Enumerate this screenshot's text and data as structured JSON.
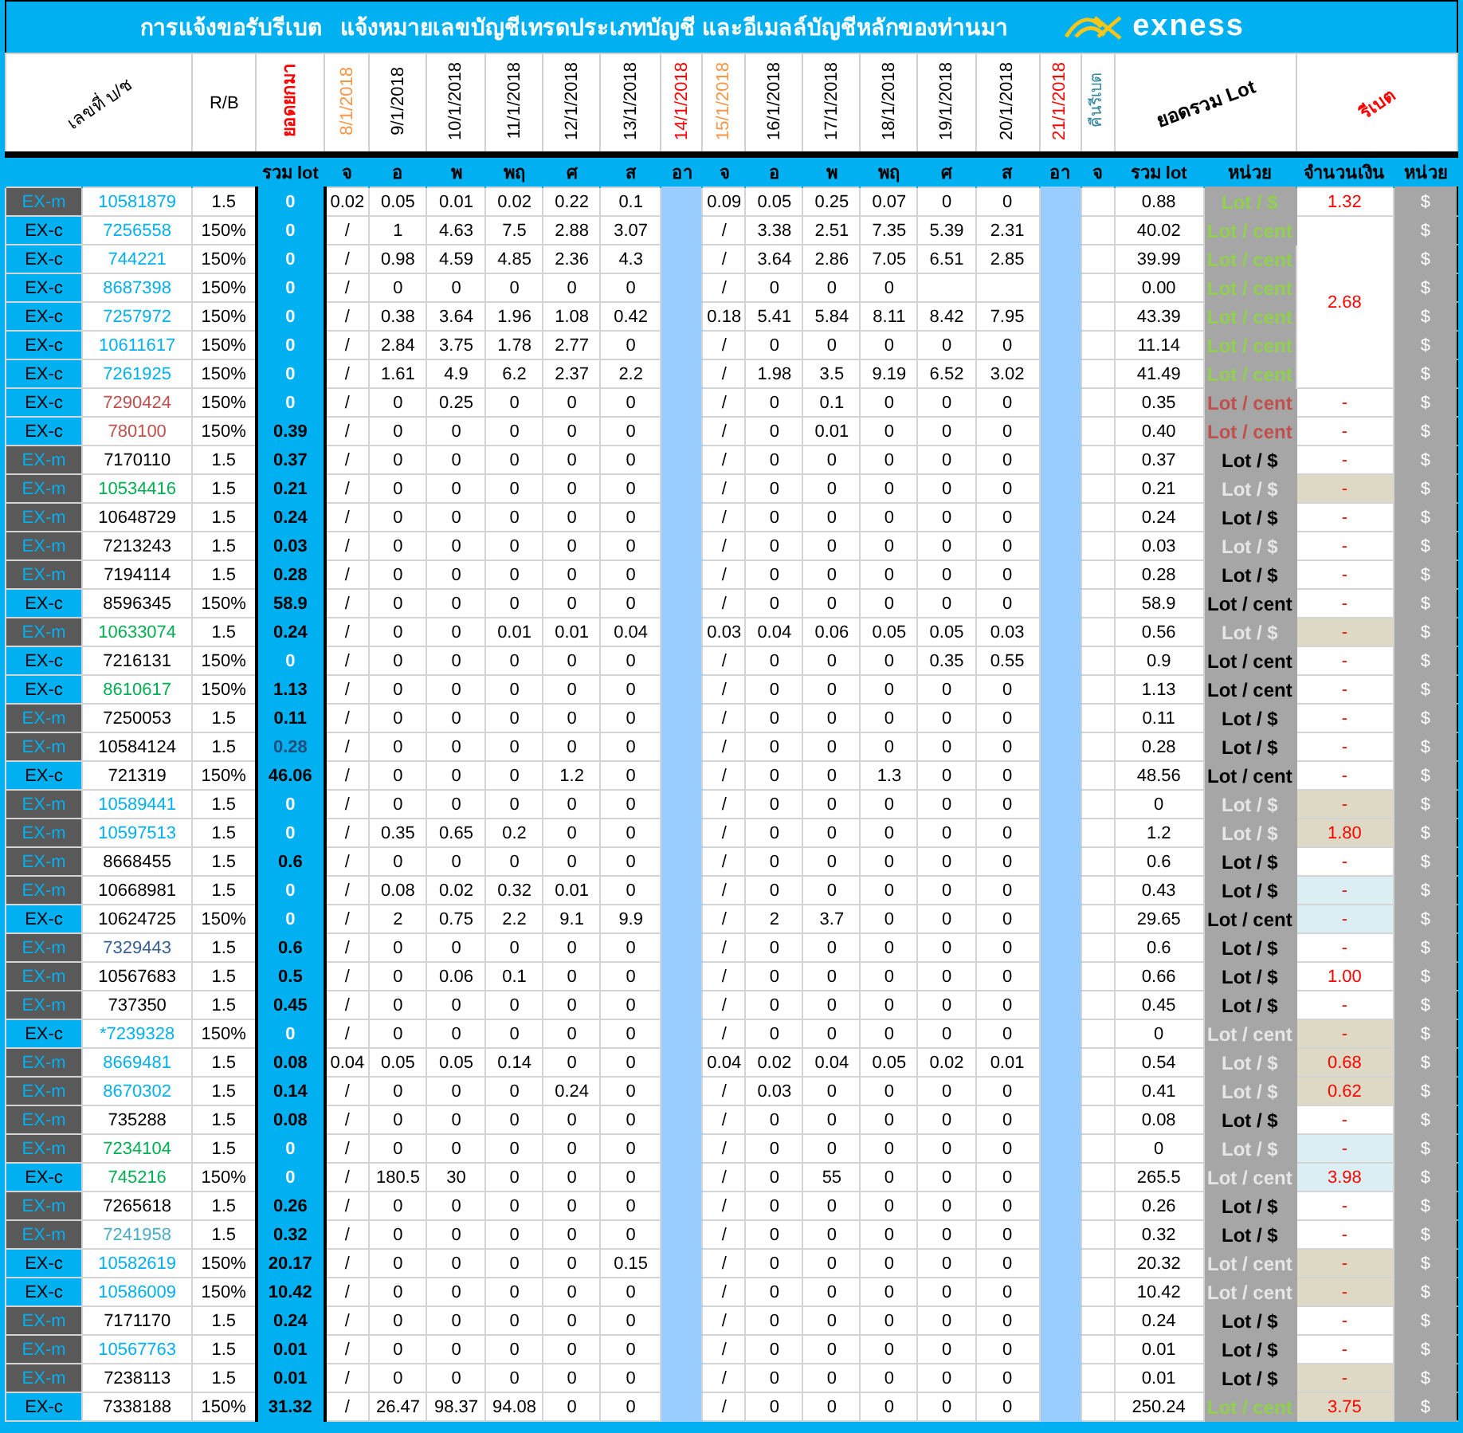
{
  "title": {
    "text": "การแจ้งขอรับรีเบต   แจ้งหมายเลขบัญชีเทรดประเภทบัญชี และอีเมลล์บัญชีหลักของท่านมา",
    "brand": "exness"
  },
  "header": {
    "account": "เลขที่ บ/ช",
    "rb": "R/B",
    "carried": {
      "text": "ยอดยกมา",
      "color": "#ff0000"
    },
    "dates": [
      {
        "text": "8/1/2018",
        "color": "#f79646"
      },
      {
        "text": "9/1/2018",
        "color": "#000000"
      },
      {
        "text": "10/1/2018",
        "color": "#000000"
      },
      {
        "text": "11/1/2018",
        "color": "#000000"
      },
      {
        "text": "12/1/2018",
        "color": "#000000"
      },
      {
        "text": "13/1/2018",
        "color": "#000000"
      },
      {
        "text": "14/1/2018",
        "color": "#ff0000"
      },
      {
        "text": "15/1/2018",
        "color": "#f79646"
      },
      {
        "text": "16/1/2018",
        "color": "#000000"
      },
      {
        "text": "17/1/2018",
        "color": "#000000"
      },
      {
        "text": "18/1/2018",
        "color": "#000000"
      },
      {
        "text": "19/1/2018",
        "color": "#000000"
      },
      {
        "text": "20/1/2018",
        "color": "#000000"
      },
      {
        "text": "21/1/2018",
        "color": "#ff0000"
      }
    ],
    "refund": {
      "text": "คืนรีเบต",
      "color": "#31859c"
    },
    "total": "ยอดรวม Lot",
    "rebate": {
      "text": "รีเบต",
      "color": "#ff0000"
    }
  },
  "subheader": {
    "carried_total": "รวม lot",
    "days": [
      "จ",
      "อ",
      "พ",
      "พฤ",
      "ศ",
      "ส",
      "อา",
      "จ",
      "อ",
      "พ",
      "พฤ",
      "ศ",
      "ส",
      "อา",
      "จ"
    ],
    "total": "รวม lot",
    "unit": "หน่วย",
    "amount": "จำนวนเงิน",
    "currency": "หน่วย"
  },
  "rows": [
    {
      "type": "EX-m",
      "kind": "m",
      "account": "10581879",
      "color": "#00b0f0",
      "rb": "1.5",
      "carried": {
        "text": "0",
        "color": "#ffffff"
      },
      "week1": [
        "0.02",
        "0.05",
        "0.01",
        "0.02",
        "0.22",
        "0.1"
      ],
      "week2": [
        "0.09",
        "0.05",
        "0.25",
        "0.07",
        "0",
        "0"
      ],
      "total": "0.88",
      "unit": {
        "text": "Lot / $",
        "color": "#92d050"
      },
      "amount": {
        "text": "1.32",
        "color": "#ffffff"
      },
      "currency": "$"
    },
    {
      "type": "EX-c",
      "kind": "c",
      "account": "7256558",
      "color": "#00b0f0",
      "rb": "150%",
      "carried": {
        "text": "0",
        "color": "#ffffff"
      },
      "week1": [
        "/",
        "1",
        "4.63",
        "7.5",
        "2.88",
        "3.07"
      ],
      "week2": [
        "/",
        "3.38",
        "2.51",
        "7.35",
        "5.39",
        "2.31"
      ],
      "total": "40.02",
      "unit": {
        "text": "Lot / cent",
        "color": "#92d050"
      },
      "amount": {
        "text": "2.68",
        "color": "#ffffff"
      },
      "currency": "$"
    },
    {
      "type": "EX-c",
      "kind": "c",
      "account": "744221",
      "color": "#00b0f0",
      "rb": "150%",
      "carried": {
        "text": "0",
        "color": "#ffffff"
      },
      "week1": [
        "/",
        "0.98",
        "4.59",
        "4.85",
        "2.36",
        "4.3"
      ],
      "week2": [
        "/",
        "3.64",
        "2.86",
        "7.05",
        "6.51",
        "2.85"
      ],
      "total": "39.99",
      "unit": {
        "text": "Lot / cent",
        "color": "#92d050"
      },
      "currency": "$"
    },
    {
      "type": "EX-c",
      "kind": "c",
      "account": "8687398",
      "color": "#00b0f0",
      "rb": "150%",
      "carried": {
        "text": "0",
        "color": "#ffffff"
      },
      "week1": [
        "/",
        "0",
        "0",
        "0",
        "0",
        "0"
      ],
      "week2": [
        "/",
        "0",
        "0",
        "0"
      ],
      "total": "0.00",
      "unit": {
        "text": "Lot / cent",
        "color": "#92d050"
      },
      "currency": "$"
    },
    {
      "type": "EX-c",
      "kind": "c",
      "account": "7257972",
      "color": "#00b0f0",
      "rb": "150%",
      "carried": {
        "text": "0",
        "color": "#ffffff"
      },
      "week1": [
        "/",
        "0.38",
        "3.64",
        "1.96",
        "1.08",
        "0.42"
      ],
      "week2": [
        "0.18",
        "5.41",
        "5.84",
        "8.11",
        "8.42",
        "7.95"
      ],
      "total": "43.39",
      "unit": {
        "text": "Lot / cent",
        "color": "#92d050"
      },
      "currency": "$"
    },
    {
      "type": "EX-c",
      "kind": "c",
      "account": "10611617",
      "color": "#00b0f0",
      "rb": "150%",
      "carried": {
        "text": "0",
        "color": "#ffffff"
      },
      "week1": [
        "/",
        "2.84",
        "3.75",
        "1.78",
        "2.77",
        "0"
      ],
      "week2": [
        "/",
        "0",
        "0",
        "0",
        "0",
        "0"
      ],
      "total": "11.14",
      "unit": {
        "text": "Lot / cent",
        "color": "#92d050"
      },
      "currency": "$"
    },
    {
      "type": "EX-c",
      "kind": "c",
      "account": "7261925",
      "color": "#00b0f0",
      "rb": "150%",
      "carried": {
        "text": "0",
        "color": "#ffffff"
      },
      "week1": [
        "/",
        "1.61",
        "4.9",
        "6.2",
        "2.37",
        "2.2"
      ],
      "week2": [
        "/",
        "1.98",
        "3.5",
        "9.19",
        "6.52",
        "3.02"
      ],
      "total": "41.49",
      "unit": {
        "text": "Lot / cent",
        "color": "#92d050"
      },
      "currency": "$"
    },
    {
      "type": "EX-c",
      "kind": "c",
      "account": "7290424",
      "color": "#c0504d",
      "rb": "150%",
      "carried": {
        "text": "0",
        "color": "#ffffff"
      },
      "week1": [
        "/",
        "0",
        "0.25",
        "0",
        "0",
        "0"
      ],
      "week2": [
        "/",
        "0",
        "0.1",
        "0",
        "0",
        "0"
      ],
      "total": "0.35",
      "unit": {
        "text": "Lot / cent",
        "color": "#c0504d"
      },
      "amount": {
        "text": "-",
        "color": "#ffffff"
      },
      "currency": "$"
    },
    {
      "type": "EX-c",
      "kind": "c",
      "account": "780100",
      "color": "#c0504d",
      "rb": "150%",
      "carried": {
        "text": "0.39",
        "color": "#000000"
      },
      "week1": [
        "/",
        "0",
        "0",
        "0",
        "0",
        "0"
      ],
      "week2": [
        "/",
        "0",
        "0.01",
        "0",
        "0",
        "0"
      ],
      "total": "0.40",
      "unit": {
        "text": "Lot / cent",
        "color": "#c0504d"
      },
      "amount": {
        "text": "-",
        "color": "#ffffff"
      },
      "currency": "$"
    },
    {
      "type": "EX-m",
      "kind": "m",
      "account": "7170110",
      "color": "#000000",
      "rb": "1.5",
      "carried": {
        "text": "0.37",
        "color": "#000000"
      },
      "week1": [
        "/",
        "0",
        "0",
        "0",
        "0",
        "0"
      ],
      "week2": [
        "/",
        "0",
        "0",
        "0",
        "0",
        "0"
      ],
      "total": "0.37",
      "unit": {
        "text": "Lot / $",
        "color": "#000000"
      },
      "amount": {
        "text": "-",
        "color": "#ffffff"
      },
      "currency": "$"
    },
    {
      "type": "EX-m",
      "kind": "m",
      "account": "10534416",
      "color": "#00b050",
      "rb": "1.5",
      "carried": {
        "text": "0.21",
        "color": "#000000"
      },
      "week1": [
        "/",
        "0",
        "0",
        "0",
        "0",
        "0"
      ],
      "week2": [
        "/",
        "0",
        "0",
        "0",
        "0",
        "0"
      ],
      "total": "0.21",
      "unit": {
        "text": "Lot / $",
        "color": "#e6e6e6"
      },
      "amount": {
        "text": "-",
        "color": "#ddd9c4"
      },
      "currency": "$"
    },
    {
      "type": "EX-m",
      "kind": "m",
      "account": "10648729",
      "color": "#000000",
      "rb": "1.5",
      "carried": {
        "text": "0.24",
        "color": "#000000"
      },
      "week1": [
        "/",
        "0",
        "0",
        "0",
        "0",
        "0"
      ],
      "week2": [
        "/",
        "0",
        "0",
        "0",
        "0",
        "0"
      ],
      "total": "0.24",
      "unit": {
        "text": "Lot / $",
        "color": "#000000"
      },
      "amount": {
        "text": "-",
        "color": "#ffffff"
      },
      "currency": "$"
    },
    {
      "type": "EX-m",
      "kind": "m",
      "account": "7213243",
      "color": "#000000",
      "rb": "1.5",
      "carried": {
        "text": "0.03",
        "color": "#000000"
      },
      "week1": [
        "/",
        "0",
        "0",
        "0",
        "0",
        "0"
      ],
      "week2": [
        "/",
        "0",
        "0",
        "0",
        "0",
        "0"
      ],
      "total": "0.03",
      "unit": {
        "text": "Lot / $",
        "color": "#e6e6e6"
      },
      "amount": {
        "text": "-",
        "color": "#ffffff"
      },
      "currency": "$"
    },
    {
      "type": "EX-m",
      "kind": "m",
      "account": "7194114",
      "color": "#000000",
      "rb": "1.5",
      "carried": {
        "text": "0.28",
        "color": "#000000"
      },
      "week1": [
        "/",
        "0",
        "0",
        "0",
        "0",
        "0"
      ],
      "week2": [
        "/",
        "0",
        "0",
        "0",
        "0",
        "0"
      ],
      "total": "0.28",
      "unit": {
        "text": "Lot / $",
        "color": "#000000"
      },
      "amount": {
        "text": "-",
        "color": "#ffffff"
      },
      "currency": "$"
    },
    {
      "type": "EX-c",
      "kind": "c",
      "account": "8596345",
      "color": "#000000",
      "rb": "150%",
      "carried": {
        "text": "58.9",
        "color": "#000000"
      },
      "week1": [
        "/",
        "0",
        "0",
        "0",
        "0",
        "0"
      ],
      "week2": [
        "/",
        "0",
        "0",
        "0",
        "0",
        "0"
      ],
      "total": "58.9",
      "unit": {
        "text": "Lot / cent",
        "color": "#000000"
      },
      "amount": {
        "text": "-",
        "color": "#ffffff"
      },
      "currency": "$"
    },
    {
      "type": "EX-m",
      "kind": "m",
      "account": "10633074",
      "color": "#00b050",
      "rb": "1.5",
      "carried": {
        "text": "0.24",
        "color": "#000000"
      },
      "week1": [
        "/",
        "0",
        "0",
        "0.01",
        "0.01",
        "0.04"
      ],
      "week2": [
        "0.03",
        "0.04",
        "0.06",
        "0.05",
        "0.05",
        "0.03"
      ],
      "total": "0.56",
      "unit": {
        "text": "Lot / $",
        "color": "#e6e6e6"
      },
      "amount": {
        "text": "-",
        "color": "#ddd9c4"
      },
      "currency": "$"
    },
    {
      "type": "EX-c",
      "kind": "c",
      "account": "7216131",
      "color": "#000000",
      "rb": "150%",
      "carried": {
        "text": "0",
        "color": "#ffffff"
      },
      "week1": [
        "/",
        "0",
        "0",
        "0",
        "0",
        "0"
      ],
      "week2": [
        "/",
        "0",
        "0",
        "0",
        "0.35",
        "0.55"
      ],
      "total": "0.9",
      "unit": {
        "text": "Lot / cent",
        "color": "#000000"
      },
      "amount": {
        "text": "-",
        "color": "#ffffff"
      },
      "currency": "$"
    },
    {
      "type": "EX-c",
      "kind": "c",
      "account": "8610617",
      "color": "#00b050",
      "rb": "150%",
      "carried": {
        "text": "1.13",
        "color": "#000000"
      },
      "week1": [
        "/",
        "0",
        "0",
        "0",
        "0",
        "0"
      ],
      "week2": [
        "/",
        "0",
        "0",
        "0",
        "0",
        "0"
      ],
      "total": "1.13",
      "unit": {
        "text": "Lot / cent",
        "color": "#000000"
      },
      "amount": {
        "text": "-",
        "color": "#ffffff"
      },
      "currency": "$"
    },
    {
      "type": "EX-m",
      "kind": "m",
      "account": "7250053",
      "color": "#000000",
      "rb": "1.5",
      "carried": {
        "text": "0.11",
        "color": "#000000"
      },
      "week1": [
        "/",
        "0",
        "0",
        "0",
        "0",
        "0"
      ],
      "week2": [
        "/",
        "0",
        "0",
        "0",
        "0",
        "0"
      ],
      "total": "0.11",
      "unit": {
        "text": "Lot / $",
        "color": "#000000"
      },
      "amount": {
        "text": "-",
        "color": "#ffffff"
      },
      "currency": "$"
    },
    {
      "type": "EX-m",
      "kind": "m",
      "account": "10584124",
      "color": "#000000",
      "rb": "1.5",
      "carried": {
        "text": "0.28",
        "color": "#1f4e79"
      },
      "week1": [
        "/",
        "0",
        "0",
        "0",
        "0",
        "0"
      ],
      "week2": [
        "/",
        "0",
        "0",
        "0",
        "0",
        "0"
      ],
      "total": "0.28",
      "unit": {
        "text": "Lot / $",
        "color": "#000000"
      },
      "amount": {
        "text": "-",
        "color": "#ffffff"
      },
      "currency": "$"
    },
    {
      "type": "EX-c",
      "kind": "c",
      "account": "721319",
      "color": "#000000",
      "rb": "150%",
      "carried": {
        "text": "46.06",
        "color": "#000000"
      },
      "week1": [
        "/",
        "0",
        "0",
        "0",
        "1.2",
        "0"
      ],
      "week2": [
        "/",
        "0",
        "0",
        "1.3",
        "0",
        "0"
      ],
      "total": "48.56",
      "unit": {
        "text": "Lot / cent",
        "color": "#000000"
      },
      "amount": {
        "text": "-",
        "color": "#ffffff"
      },
      "currency": "$"
    },
    {
      "type": "EX-m",
      "kind": "m",
      "account": "10589441",
      "color": "#00b0f0",
      "rb": "1.5",
      "carried": {
        "text": "0",
        "color": "#ffffff"
      },
      "week1": [
        "/",
        "0",
        "0",
        "0",
        "0",
        "0"
      ],
      "week2": [
        "/",
        "0",
        "0",
        "0",
        "0",
        "0"
      ],
      "total": "0",
      "unit": {
        "text": "Lot / $",
        "color": "#e6e6e6"
      },
      "amount": {
        "text": "-",
        "color": "#ddd9c4"
      },
      "currency": "$"
    },
    {
      "type": "EX-m",
      "kind": "m",
      "account": "10597513",
      "color": "#00b0f0",
      "rb": "1.5",
      "carried": {
        "text": "0",
        "color": "#ffffff"
      },
      "week1": [
        "/",
        "0.35",
        "0.65",
        "0.2",
        "0",
        "0"
      ],
      "week2": [
        "/",
        "0",
        "0",
        "0",
        "0",
        "0"
      ],
      "total": "1.2",
      "unit": {
        "text": "Lot / $",
        "color": "#e6e6e6"
      },
      "amount": {
        "text": "1.80",
        "color": "#ddd9c4"
      },
      "currency": "$"
    },
    {
      "type": "EX-m",
      "kind": "m",
      "account": "8668455",
      "color": "#000000",
      "rb": "1.5",
      "carried": {
        "text": "0.6",
        "color": "#000000"
      },
      "week1": [
        "/",
        "0",
        "0",
        "0",
        "0",
        "0"
      ],
      "week2": [
        "/",
        "0",
        "0",
        "0",
        "0",
        "0"
      ],
      "total": "0.6",
      "unit": {
        "text": "Lot / $",
        "color": "#000000"
      },
      "amount": {
        "text": "-",
        "color": "#ffffff"
      },
      "currency": "$"
    },
    {
      "type": "EX-m",
      "kind": "m",
      "account": "10668981",
      "color": "#000000",
      "rb": "1.5",
      "carried": {
        "text": "0",
        "color": "#ffffff"
      },
      "week1": [
        "/",
        "0.08",
        "0.02",
        "0.32",
        "0.01",
        "0"
      ],
      "week2": [
        "/",
        "0",
        "0",
        "0",
        "0",
        "0"
      ],
      "total": "0.43",
      "unit": {
        "text": "Lot / $",
        "color": "#000000"
      },
      "amount": {
        "text": "-",
        "color": "#daeef3"
      },
      "currency": "$"
    },
    {
      "type": "EX-c",
      "kind": "c",
      "account": "10624725",
      "color": "#000000",
      "rb": "150%",
      "carried": {
        "text": "0",
        "color": "#ffffff"
      },
      "week1": [
        "/",
        "2",
        "0.75",
        "2.2",
        "9.1",
        "9.9"
      ],
      "week2": [
        "/",
        "2",
        "3.7",
        "0",
        "0",
        "0"
      ],
      "total": "29.65",
      "unit": {
        "text": "Lot / cent",
        "color": "#000000"
      },
      "amount": {
        "text": "-",
        "color": "#daeef3"
      },
      "currency": "$"
    },
    {
      "type": "EX-m",
      "kind": "m",
      "account": "7329443",
      "color": "#366092",
      "rb": "1.5",
      "carried": {
        "text": "0.6",
        "color": "#000000"
      },
      "week1": [
        "/",
        "0",
        "0",
        "0",
        "0",
        "0"
      ],
      "week2": [
        "/",
        "0",
        "0",
        "0",
        "0",
        "0"
      ],
      "total": "0.6",
      "unit": {
        "text": "Lot / $",
        "color": "#000000"
      },
      "amount": {
        "text": "-",
        "color": "#ffffff"
      },
      "currency": "$"
    },
    {
      "type": "EX-m",
      "kind": "m",
      "account": "10567683",
      "color": "#000000",
      "rb": "1.5",
      "carried": {
        "text": "0.5",
        "color": "#000000"
      },
      "week1": [
        "/",
        "0",
        "0.06",
        "0.1",
        "0",
        "0"
      ],
      "week2": [
        "/",
        "0",
        "0",
        "0",
        "0",
        "0"
      ],
      "total": "0.66",
      "unit": {
        "text": "Lot / $",
        "color": "#000000"
      },
      "amount": {
        "text": "1.00",
        "color": "#ffffff"
      },
      "currency": "$"
    },
    {
      "type": "EX-m",
      "kind": "m",
      "account": "737350",
      "color": "#000000",
      "rb": "1.5",
      "carried": {
        "text": "0.45",
        "color": "#000000"
      },
      "week1": [
        "/",
        "0",
        "0",
        "0",
        "0",
        "0"
      ],
      "week2": [
        "/",
        "0",
        "0",
        "0",
        "0",
        "0"
      ],
      "total": "0.45",
      "unit": {
        "text": "Lot / $",
        "color": "#000000"
      },
      "amount": {
        "text": "-",
        "color": "#ffffff"
      },
      "currency": "$"
    },
    {
      "type": "EX-c",
      "kind": "c",
      "account": "*7239328",
      "color": "#00b0f0",
      "rb": "150%",
      "carried": {
        "text": "0",
        "color": "#ffffff"
      },
      "week1": [
        "/",
        "0",
        "0",
        "0",
        "0",
        "0"
      ],
      "week2": [
        "/",
        "0",
        "0",
        "0",
        "0",
        "0"
      ],
      "total": "0",
      "unit": {
        "text": "Lot / cent",
        "color": "#e6e6e6"
      },
      "amount": {
        "text": "-",
        "color": "#ddd9c4"
      },
      "currency": "$"
    },
    {
      "type": "EX-m",
      "kind": "m",
      "account": "8669481",
      "color": "#00b0f0",
      "rb": "1.5",
      "carried": {
        "text": "0.08",
        "color": "#000000"
      },
      "week1": [
        "0.04",
        "0.05",
        "0.05",
        "0.14",
        "0",
        "0"
      ],
      "week2": [
        "0.04",
        "0.02",
        "0.04",
        "0.05",
        "0.02",
        "0.01"
      ],
      "total": "0.54",
      "unit": {
        "text": "Lot / $",
        "color": "#e6e6e6"
      },
      "amount": {
        "text": "0.68",
        "color": "#ddd9c4"
      },
      "currency": "$"
    },
    {
      "type": "EX-m",
      "kind": "m",
      "account": "8670302",
      "color": "#00b0f0",
      "rb": "1.5",
      "carried": {
        "text": "0.14",
        "color": "#000000"
      },
      "week1": [
        "/",
        "0",
        "0",
        "0",
        "0.24",
        "0"
      ],
      "week2": [
        "/",
        "0.03",
        "0",
        "0",
        "0",
        "0"
      ],
      "total": "0.41",
      "unit": {
        "text": "Lot / $",
        "color": "#e6e6e6"
      },
      "amount": {
        "text": "0.62",
        "color": "#ddd9c4"
      },
      "currency": "$"
    },
    {
      "type": "EX-m",
      "kind": "m",
      "account": "735288",
      "color": "#000000",
      "rb": "1.5",
      "carried": {
        "text": "0.08",
        "color": "#000000"
      },
      "week1": [
        "/",
        "0",
        "0",
        "0",
        "0",
        "0"
      ],
      "week2": [
        "/",
        "0",
        "0",
        "0",
        "0",
        "0"
      ],
      "total": "0.08",
      "unit": {
        "text": "Lot / $",
        "color": "#000000"
      },
      "amount": {
        "text": "-",
        "color": "#ffffff"
      },
      "currency": "$"
    },
    {
      "type": "EX-m",
      "kind": "m",
      "account": "7234104",
      "color": "#00b050",
      "rb": "1.5",
      "carried": {
        "text": "0",
        "color": "#ffffff"
      },
      "week1": [
        "/",
        "0",
        "0",
        "0",
        "0",
        "0"
      ],
      "week2": [
        "/",
        "0",
        "0",
        "0",
        "0",
        "0"
      ],
      "total": "0",
      "unit": {
        "text": "Lot / $",
        "color": "#e6e6e6"
      },
      "amount": {
        "text": "-",
        "color": "#daeef3"
      },
      "currency": "$"
    },
    {
      "type": "EX-c",
      "kind": "c",
      "account": "745216",
      "color": "#00b050",
      "rb": "150%",
      "carried": {
        "text": "0",
        "color": "#ffffff"
      },
      "week1": [
        "/",
        "180.5",
        "30",
        "0",
        "0",
        "0"
      ],
      "week2": [
        "/",
        "0",
        "55",
        "0",
        "0",
        "0"
      ],
      "total": "265.5",
      "unit": {
        "text": "Lot / cent",
        "color": "#e6e6e6"
      },
      "amount": {
        "text": "3.98",
        "color": "#daeef3"
      },
      "currency": "$"
    },
    {
      "type": "EX-m",
      "kind": "m",
      "account": "7265618",
      "color": "#000000",
      "rb": "1.5",
      "carried": {
        "text": "0.26",
        "color": "#000000"
      },
      "week1": [
        "/",
        "0",
        "0",
        "0",
        "0",
        "0"
      ],
      "week2": [
        "/",
        "0",
        "0",
        "0",
        "0",
        "0"
      ],
      "total": "0.26",
      "unit": {
        "text": "Lot / $",
        "color": "#000000"
      },
      "amount": {
        "text": "-",
        "color": "#ffffff"
      },
      "currency": "$"
    },
    {
      "type": "EX-m",
      "kind": "m",
      "account": "7241958",
      "color": "#4bacc6",
      "rb": "1.5",
      "carried": {
        "text": "0.32",
        "color": "#000000"
      },
      "week1": [
        "/",
        "0",
        "0",
        "0",
        "0",
        "0"
      ],
      "week2": [
        "/",
        "0",
        "0",
        "0",
        "0",
        "0"
      ],
      "total": "0.32",
      "unit": {
        "text": "Lot / $",
        "color": "#000000"
      },
      "amount": {
        "text": "-",
        "color": "#ffffff"
      },
      "currency": "$"
    },
    {
      "type": "EX-c",
      "kind": "c",
      "account": "10582619",
      "color": "#00b0f0",
      "rb": "150%",
      "carried": {
        "text": "20.17",
        "color": "#000000"
      },
      "week1": [
        "/",
        "0",
        "0",
        "0",
        "0",
        "0.15"
      ],
      "week2": [
        "/",
        "0",
        "0",
        "0",
        "0",
        "0"
      ],
      "total": "20.32",
      "unit": {
        "text": "Lot / cent",
        "color": "#e6e6e6"
      },
      "amount": {
        "text": "-",
        "color": "#ddd9c4"
      },
      "currency": "$"
    },
    {
      "type": "EX-c",
      "kind": "c",
      "account": "10586009",
      "color": "#00b0f0",
      "rb": "150%",
      "carried": {
        "text": "10.42",
        "color": "#000000"
      },
      "week1": [
        "/",
        "0",
        "0",
        "0",
        "0",
        "0"
      ],
      "week2": [
        "/",
        "0",
        "0",
        "0",
        "0",
        "0"
      ],
      "total": "10.42",
      "unit": {
        "text": "Lot / cent",
        "color": "#e6e6e6"
      },
      "amount": {
        "text": "-",
        "color": "#ddd9c4"
      },
      "currency": "$"
    },
    {
      "type": "EX-m",
      "kind": "m",
      "account": "7171170",
      "color": "#000000",
      "rb": "1.5",
      "carried": {
        "text": "0.24",
        "color": "#000000"
      },
      "week1": [
        "/",
        "0",
        "0",
        "0",
        "0",
        "0"
      ],
      "week2": [
        "/",
        "0",
        "0",
        "0",
        "0",
        "0"
      ],
      "total": "0.24",
      "unit": {
        "text": "Lot / $",
        "color": "#000000"
      },
      "amount": {
        "text": "-",
        "color": "#ffffff"
      },
      "currency": "$"
    },
    {
      "type": "EX-m",
      "kind": "m",
      "account": "10567763",
      "color": "#00b0f0",
      "rb": "1.5",
      "carried": {
        "text": "0.01",
        "color": "#000000"
      },
      "week1": [
        "/",
        "0",
        "0",
        "0",
        "0",
        "0"
      ],
      "week2": [
        "/",
        "0",
        "0",
        "0",
        "0",
        "0"
      ],
      "total": "0.01",
      "unit": {
        "text": "Lot / $",
        "color": "#000000"
      },
      "amount": {
        "text": "-",
        "color": "#ffffff"
      },
      "currency": "$"
    },
    {
      "type": "EX-m",
      "kind": "m",
      "account": "7238113",
      "color": "#000000",
      "rb": "1.5",
      "carried": {
        "text": "0.01",
        "color": "#000000"
      },
      "week1": [
        "/",
        "0",
        "0",
        "0",
        "0",
        "0"
      ],
      "week2": [
        "/",
        "0",
        "0",
        "0",
        "0",
        "0"
      ],
      "total": "0.01",
      "unit": {
        "text": "Lot / $",
        "color": "#000000"
      },
      "amount": {
        "text": "-",
        "color": "#ddd9c4"
      },
      "currency": "$"
    },
    {
      "type": "EX-c",
      "kind": "c",
      "account": "7338188",
      "color": "#000000",
      "rb": "150%",
      "carried": {
        "text": "31.32",
        "color": "#000000"
      },
      "week1": [
        "/",
        "26.47",
        "98.37",
        "94.08",
        "0",
        "0"
      ],
      "week2": [
        "/",
        "0",
        "0",
        "0",
        "0",
        "0"
      ],
      "total": "250.24",
      "unit": {
        "text": "Lot / cent",
        "color": "#92d050"
      },
      "amount": {
        "text": "3.75",
        "color": "#ddd9c4"
      },
      "currency": "$"
    }
  ]
}
